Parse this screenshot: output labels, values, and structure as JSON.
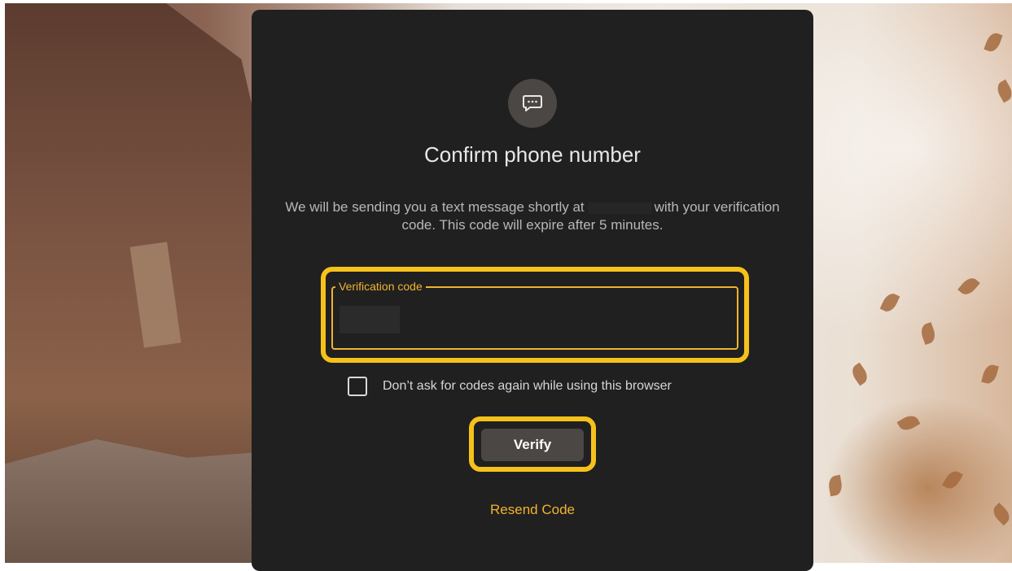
{
  "dialog": {
    "title": "Confirm phone number",
    "description_part1": "We will be sending you a text message shortly at",
    "description_part2": "with your verification code. This code will expire after 5 minutes.",
    "phone_number_redacted": "",
    "field": {
      "label": "Verification code",
      "value": ""
    },
    "checkbox": {
      "label": "Don’t ask for codes again while using this browser",
      "checked": false
    },
    "verify_label": "Verify",
    "resend_label": "Resend Code",
    "icon": "message-icon"
  },
  "colors": {
    "card_bg": "#202020",
    "accent": "#f0b32d",
    "highlight": "#f6c11a",
    "button_bg": "#4a4744"
  }
}
